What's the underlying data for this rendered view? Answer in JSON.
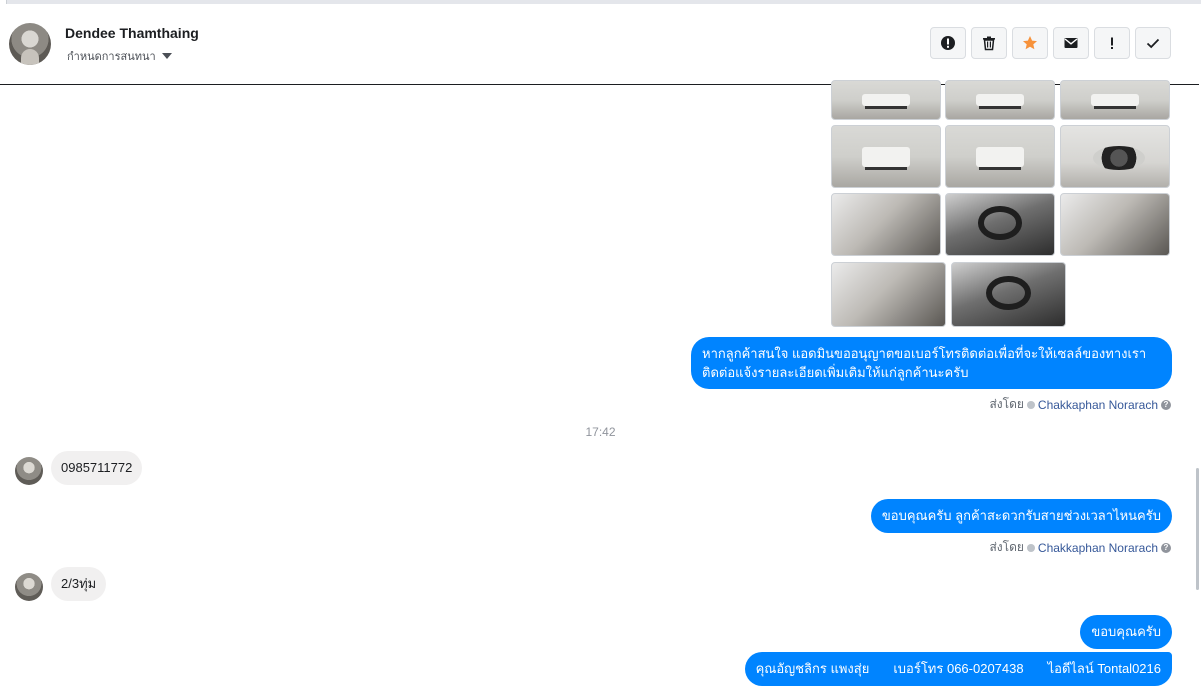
{
  "header": {
    "contact_name": "Dendee Thamthaing",
    "subtitle": "กำหนดการสนทนา",
    "toolbar": [
      {
        "name": "spam-button",
        "icon": "alert-circle-icon"
      },
      {
        "name": "delete-button",
        "icon": "trash-icon"
      },
      {
        "name": "star-button",
        "icon": "star-icon"
      },
      {
        "name": "mark-unread-button",
        "icon": "envelope-icon"
      },
      {
        "name": "important-button",
        "icon": "exclamation-icon"
      },
      {
        "name": "done-button",
        "icon": "check-icon"
      }
    ],
    "star_color": "#f7923b"
  },
  "messages": {
    "out1_line1": "หากลูกค้าสนใจ แอดมินขออนุญาตขอเบอร์โทรติดต่อเพื่อที่จะให้เซลล์ของทางเรา",
    "out1_line2": "ติดต่อแจ้งรายละเอียดเพิ่มเติมให้แก่ลูกค้านะครับ",
    "sent_by_label": "ส่งโดย",
    "agent_name": "Chakkaphan Norarach",
    "timestamp": "17:42",
    "in1": "0985711772",
    "out2": "ขอบคุณครับ ลูกค้าสะดวกรับสายช่วงเวลาไหนครับ",
    "in2": "2/3ทุ่ม",
    "out3": "ขอบคุณครับ",
    "out4_part1": "คุณอัญชลิกร แพงสุ่ย",
    "out4_part2": "เบอร์โทร 066-0207438",
    "out4_part3": "ไอดีไลน์ Tontal0216"
  },
  "colors": {
    "outgoing_bubble": "#0084ff",
    "incoming_bubble": "#f1f0f0",
    "agent_link": "#365899"
  }
}
